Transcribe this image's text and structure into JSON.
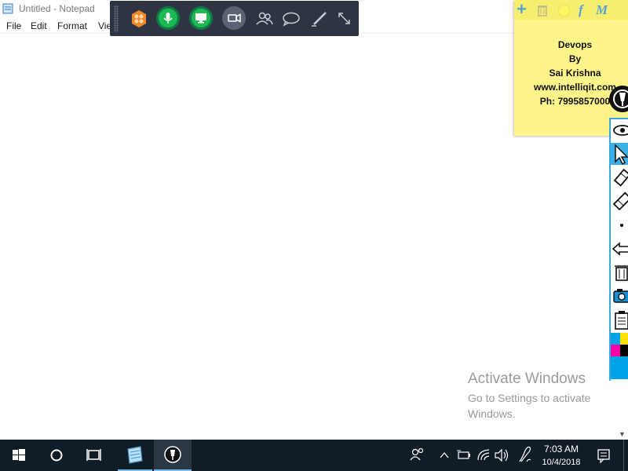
{
  "notepad": {
    "title": "Untitled - Notepad",
    "menu": [
      "File",
      "Edit",
      "Format",
      "Vie"
    ]
  },
  "recorder_toolbar": {
    "buttons": [
      "app-logo",
      "microphone",
      "screen-share",
      "camera",
      "participants",
      "chat",
      "pen",
      "resize"
    ]
  },
  "sticky_note": {
    "toolbar": [
      "+",
      "trash",
      "color",
      "f",
      "M"
    ],
    "lines": [
      "Devops",
      "By",
      "Sai Krishna",
      "www.intelliqit.com",
      "Ph: 7995857000"
    ]
  },
  "palette": {
    "tools": [
      "eye",
      "pointer",
      "highlighter",
      "eraser",
      "dot",
      "undo",
      "clear",
      "camera",
      "clipboard"
    ],
    "colors": [
      "#00a2e8",
      "#ffe100",
      "#ff00a8",
      "#000000",
      "#00a2e8",
      "#00a2e8"
    ]
  },
  "watermark": {
    "title": "Activate Windows",
    "subtitle": "Go to Settings to activate Windows."
  },
  "taskbar": {
    "time": "7:03 AM",
    "date": "10/4/2018"
  },
  "colors": {
    "taskbar": "#101c26",
    "toolbar": "#2e3441",
    "green": "#1db954",
    "sticky": "#fdf58a",
    "accent": "#3ab0e6"
  }
}
